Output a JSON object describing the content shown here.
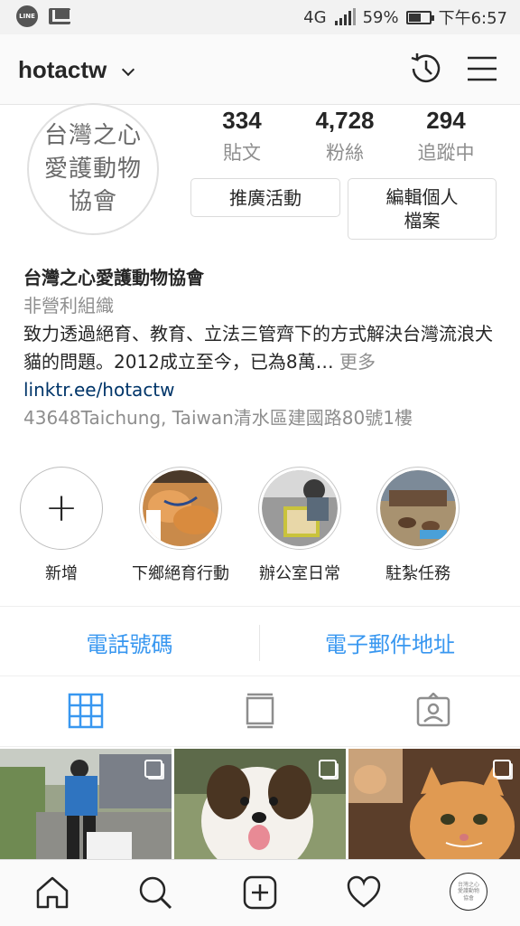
{
  "status_bar": {
    "network": "4G",
    "battery": "59%",
    "battery_level": 0.59,
    "time": "下午6:57"
  },
  "header": {
    "username": "hotactw"
  },
  "profile": {
    "avatar_text": [
      "台灣之心",
      "愛護動物",
      "協會"
    ],
    "stats": [
      {
        "value": "334",
        "label": "貼文"
      },
      {
        "value": "4,728",
        "label": "粉絲"
      },
      {
        "value": "294",
        "label": "追蹤中"
      }
    ],
    "promote_button": "推廣活動",
    "edit_button": "編輯個人檔案",
    "name": "台灣之心愛護動物協會",
    "category": "非營利組織",
    "bio": "致力透過絕育、教育、立法三管齊下的方式解決台灣流浪犬貓的問題。2012成立至今，已為8萬…",
    "more": "更多",
    "link": "linktr.ee/hotactw",
    "address": "43648Taichung, Taiwan清水區建國路80號1樓"
  },
  "highlights": [
    {
      "label": "新增"
    },
    {
      "label": "下鄉絕育行動"
    },
    {
      "label": "辦公室日常"
    },
    {
      "label": "駐紮任務"
    }
  ],
  "contact": {
    "phone": "電話號碼",
    "email": "電子郵件地址"
  },
  "colors": {
    "link_blue": "#3897f0",
    "tab_active": "#3897f0",
    "text": "#262626",
    "muted": "#8e8e8e"
  }
}
